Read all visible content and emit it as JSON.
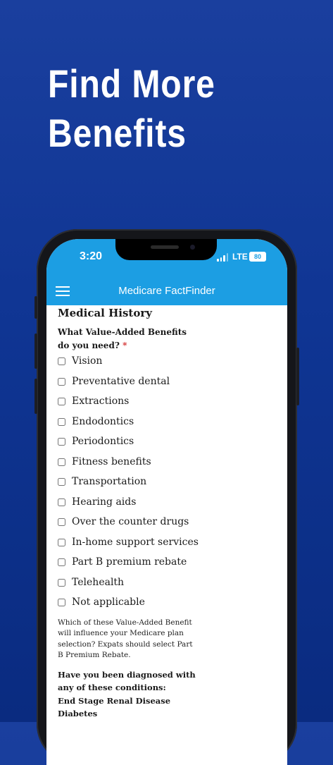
{
  "promo": {
    "headline_line1": "Find More",
    "headline_line2": "Benefits"
  },
  "status_bar": {
    "time": "3:20",
    "network": "LTE",
    "battery": "80"
  },
  "app_bar": {
    "title": "Medicare FactFinder"
  },
  "form": {
    "section_title": "Medical History",
    "benefits_question": "What Value-Added Benefits do you need?",
    "required_marker": "*",
    "benefit_options": [
      "Vision",
      "Preventative dental",
      "Extractions",
      "Endodontics",
      "Periodontics",
      "Fitness benefits",
      "Transportation",
      "Hearing aids",
      "Over the counter drugs",
      "In-home support services",
      "Part B premium rebate",
      "Telehealth",
      "Not applicable"
    ],
    "benefits_help": "Which of these Value-Added Benefit will influence your Medicare plan selection? Expats should select Part B Premium Rebate.",
    "conditions_question": "Have you been diagnosed with any of these conditions:",
    "conditions": [
      "End Stage Renal Disease",
      "Diabetes"
    ]
  },
  "colors": {
    "background": "#0f3593",
    "app_bar": "#1c9ee3",
    "required": "#d32f2f"
  }
}
